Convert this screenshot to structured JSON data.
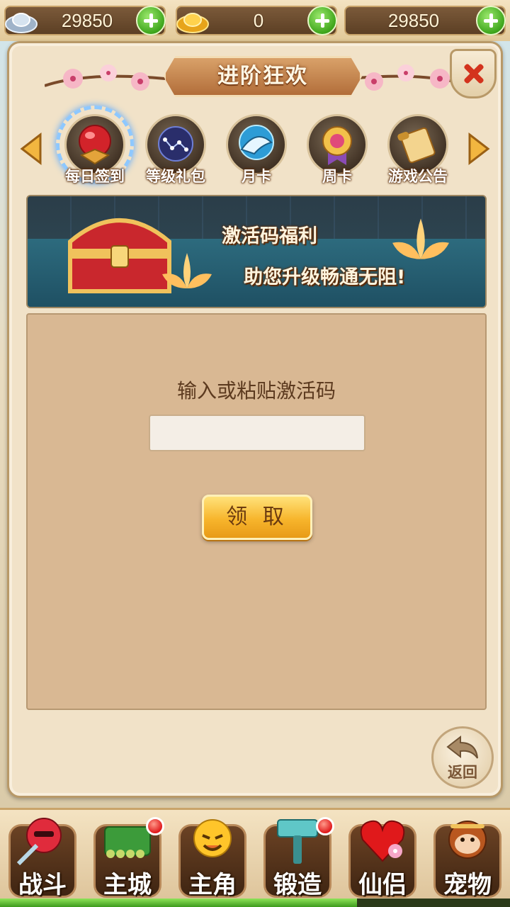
{
  "currency": {
    "silver": "29850",
    "gold": "0",
    "third": "29850"
  },
  "panel": {
    "title": "进阶狂欢"
  },
  "tabs": [
    {
      "label": "每日签到",
      "icon": "red-pearl-icon"
    },
    {
      "label": "等级礼包",
      "icon": "constellation-orb-icon"
    },
    {
      "label": "月卡",
      "icon": "blue-dragon-icon"
    },
    {
      "label": "周卡",
      "icon": "medal-icon"
    },
    {
      "label": "游戏公告",
      "icon": "scroll-icon"
    }
  ],
  "banner": {
    "line1": "激活码福利",
    "line2": "助您升级畅通无阻!"
  },
  "redeem": {
    "prompt": "输入或粘贴激活码",
    "input_value": "",
    "claim_label": "领 取"
  },
  "back": {
    "label": "返回"
  },
  "nav": [
    {
      "label": "战斗",
      "icon": "ninja-icon",
      "badge": false
    },
    {
      "label": "主城",
      "icon": "city-gate-icon",
      "badge": true
    },
    {
      "label": "主角",
      "icon": "smiley-hero-icon",
      "badge": false
    },
    {
      "label": "锻造",
      "icon": "hammer-icon",
      "badge": true
    },
    {
      "label": "仙侣",
      "icon": "heart-flower-icon",
      "badge": false
    },
    {
      "label": "宠物",
      "icon": "monkey-icon",
      "badge": false
    }
  ],
  "experience_progress": 0.7,
  "colors": {
    "accent": "#f7b52c",
    "panel_bg": "#f1e2c8",
    "content_bg": "#d9b893",
    "badge": "#e0191b"
  }
}
